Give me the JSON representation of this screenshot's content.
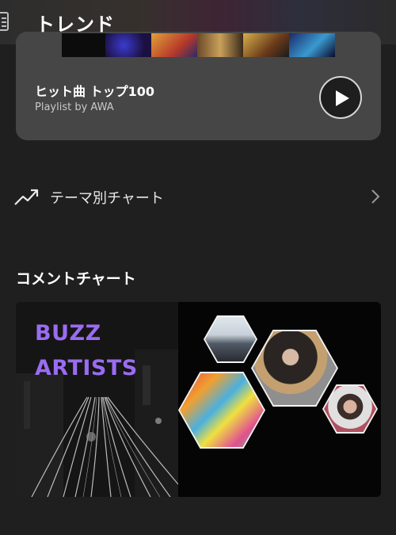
{
  "header": {
    "title": "トレンド"
  },
  "playlist_card": {
    "title": "ヒット曲 トップ100",
    "subtitle": "Playlist by AWA"
  },
  "theme_row": {
    "label": "テーマ別チャート"
  },
  "comment_section": {
    "title": "コメントチャート"
  },
  "banner": {
    "line1": "BUZZ",
    "line2": "ARTISTS"
  },
  "colors": {
    "background": "#1f1f1f",
    "card": "#464646",
    "buzz_text": "#9a6cf2"
  },
  "icons": [
    "menu-icon",
    "play-icon",
    "trending-up-icon",
    "chevron-right-icon"
  ]
}
